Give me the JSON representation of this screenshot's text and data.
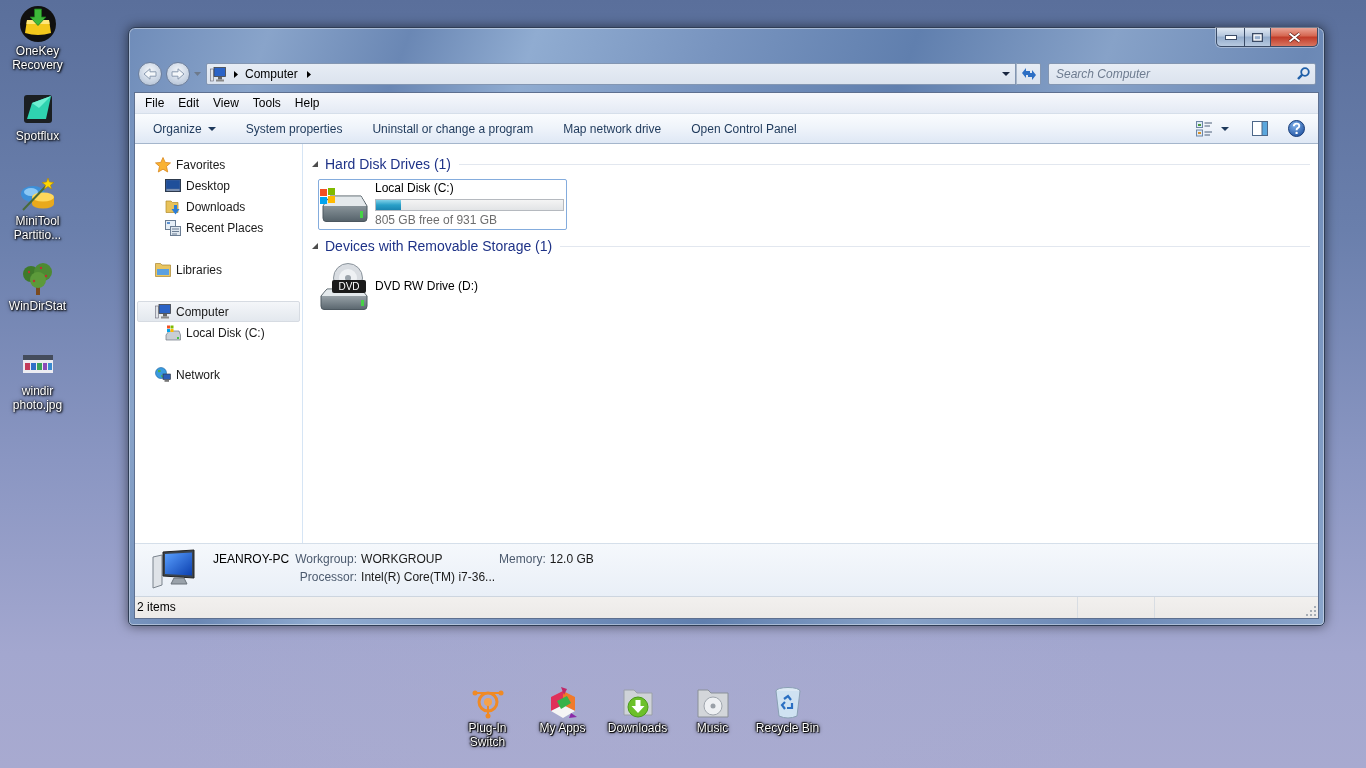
{
  "desktop_icons": [
    {
      "label": "OneKey Recovery",
      "kind": "arrowdisc"
    },
    {
      "label": "Spotflux",
      "kind": "tile"
    },
    {
      "label": "MiniTool Partitio...",
      "kind": "wand"
    },
    {
      "label": "WinDirStat",
      "kind": "tree"
    },
    {
      "label": "windir photo.jpg",
      "kind": "picture"
    }
  ],
  "window": {
    "address": {
      "crumbs": [
        "Computer"
      ]
    },
    "search": {
      "placeholder": "Search Computer"
    },
    "menu": [
      "File",
      "Edit",
      "View",
      "Tools",
      "Help"
    ],
    "commands": [
      {
        "label": "Organize",
        "dropdown": true
      },
      {
        "label": "System properties",
        "dropdown": false
      },
      {
        "label": "Uninstall or change a program",
        "dropdown": false
      },
      {
        "label": "Map network drive",
        "dropdown": false
      },
      {
        "label": "Open Control Panel",
        "dropdown": false
      }
    ],
    "sidebar": {
      "sections": [
        {
          "label": "Favorites",
          "kind": "star",
          "selected": false,
          "children": [
            {
              "label": "Desktop",
              "kind": "desktop",
              "selected": false
            },
            {
              "label": "Downloads",
              "kind": "downloads",
              "selected": false
            },
            {
              "label": "Recent Places",
              "kind": "recent",
              "selected": false
            }
          ]
        },
        {
          "label": "Libraries",
          "kind": "libraries",
          "selected": false
        },
        {
          "label": "Computer",
          "kind": "computer",
          "selected": true,
          "children": [
            {
              "label": "Local Disk (C:)",
              "kind": "disk",
              "selected": false
            }
          ]
        },
        {
          "label": "Network",
          "kind": "network",
          "selected": false
        }
      ]
    },
    "groups": [
      {
        "title": "Hard Disk Drives (1)",
        "expanded": true,
        "items": [
          {
            "name": "Local Disk (C:)",
            "kind": "harddisk",
            "level": 0.135,
            "detail": "805 GB free of 931 GB",
            "selected": true
          }
        ]
      },
      {
        "title": "Devices with Removable Storage (1)",
        "expanded": true,
        "items": [
          {
            "name": "DVD RW Drive (D:)",
            "kind": "dvd",
            "icon_text": "DVD",
            "selected": false
          }
        ]
      }
    ],
    "details": {
      "name": "JEANROY-PC",
      "fields": [
        {
          "label": "Workgroup:",
          "value": "WORKGROUP"
        },
        {
          "label": "Memory:",
          "value": "12.0 GB"
        },
        {
          "label": "Processor:",
          "value": "Intel(R) Core(TM) i7-36..."
        }
      ]
    },
    "status_bar": {
      "text": "2 items"
    }
  },
  "dock": [
    {
      "label": "Plug-In Switch",
      "kind": "emblem"
    },
    {
      "label": "My Apps",
      "kind": "cube"
    },
    {
      "label": "Downloads",
      "kind": "download"
    },
    {
      "label": "Music",
      "kind": "disc"
    },
    {
      "label": "Recycle Bin",
      "kind": "bin"
    }
  ]
}
